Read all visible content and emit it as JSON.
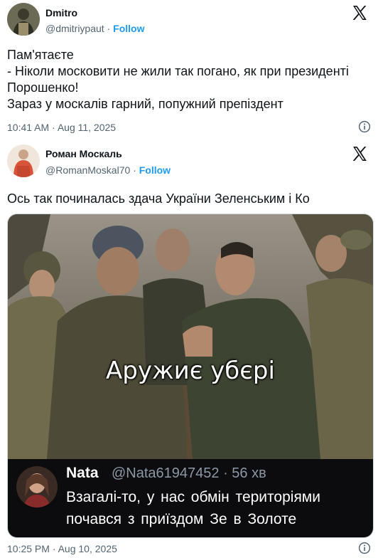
{
  "tweet1": {
    "display_name": "Dmitro",
    "handle": "@dmitriypaut",
    "separator": "·",
    "follow_label": "Follow",
    "text": "Пам'ятаєте\n- Ніколи московити не жили так погано, як при президенті Порошенко!\nЗараз у москалів гарний, попужний препіздент",
    "timestamp": "10:41 AM · Aug 11, 2025"
  },
  "tweet2": {
    "display_name": "Роман Москаль",
    "handle": "@RomanMoskal70",
    "separator": "·",
    "follow_label": "Follow",
    "text": "Ось так починалась здача України Зеленським і Ко",
    "timestamp": "10:25 PM · Aug 10, 2025",
    "media": {
      "caption": "Аружиє убєрі",
      "reply": {
        "name": "Nata",
        "meta": "@Nata61947452 · 56 хв",
        "text": "Взагалі-то,  у  нас обмін територіями\nпочався  з приїздом  Зе  в Золоте"
      }
    }
  },
  "colors": {
    "text": "#0f1419",
    "secondary": "#536471",
    "link": "#1d9bf0",
    "reply_bg": "#0c0c0e"
  },
  "icons": [
    "x-logo-icon",
    "info-icon"
  ]
}
